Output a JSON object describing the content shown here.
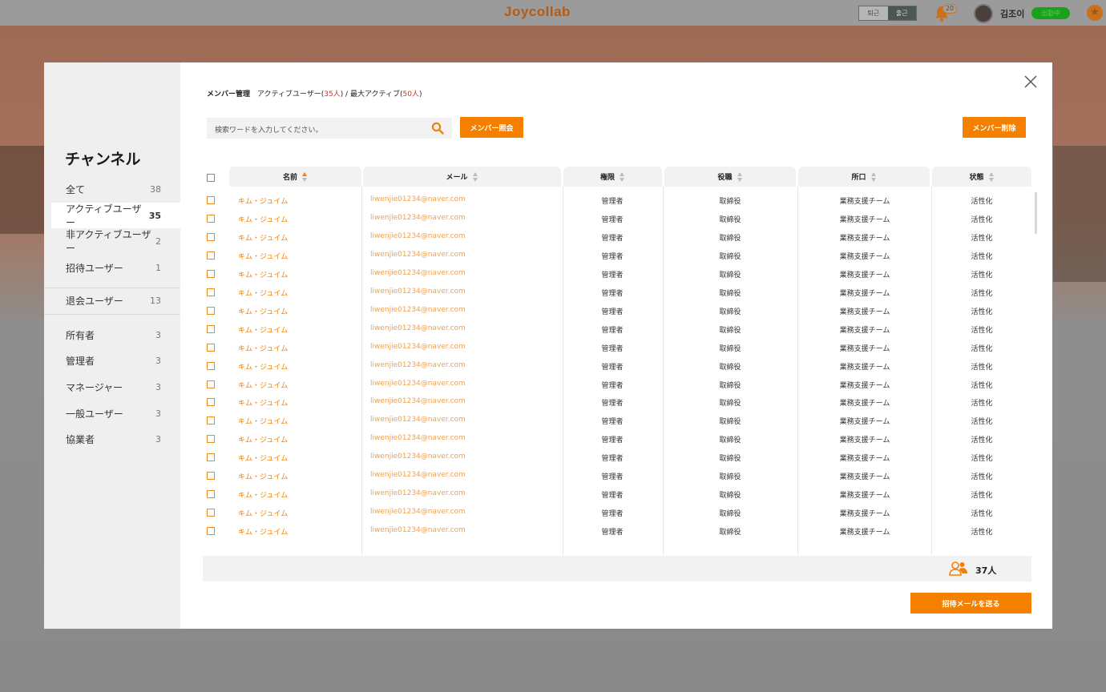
{
  "app": {
    "brand": "Joycollab",
    "toggle": [
      "퇴근",
      "출근"
    ],
    "notification_count": "20",
    "user_name": "김조이",
    "status": "出勤中"
  },
  "sidebar": {
    "title": "チャンネル",
    "groups": [
      [
        {
          "label": "全て",
          "count": "38"
        },
        {
          "label": "アクティブユーザー",
          "count": "35"
        },
        {
          "label": "非アクティブユーザー",
          "count": "2"
        },
        {
          "label": "招待ユーザー",
          "count": "1"
        }
      ],
      [
        {
          "label": "退会ユーザー",
          "count": "13"
        }
      ],
      [
        {
          "label": "所有者",
          "count": "3"
        },
        {
          "label": "管理者",
          "count": "3"
        },
        {
          "label": "マネージャー",
          "count": "3"
        },
        {
          "label": "一般ユーザー",
          "count": "3"
        },
        {
          "label": "協業者",
          "count": "3"
        }
      ]
    ]
  },
  "header": {
    "title": "メンバー管理",
    "active_label": "アクティブユーザー(",
    "active_count": "35人",
    "separator": ") / 最大アクティブ(",
    "max_count": "50人",
    "close_paren": ")"
  },
  "search": {
    "placeholder": "検索ワードを入力してください。"
  },
  "buttons": {
    "lookup": "メンバー照会",
    "delete": "メンバー削除",
    "invite": "招待メールを送る"
  },
  "table": {
    "columns": [
      "名前",
      "メール",
      "権限",
      "役職",
      "所口",
      "状態"
    ],
    "rows": [
      {
        "name": "キム・ジュイム",
        "email": "liwenjie01234@naver.com",
        "role": "管理者",
        "position": "取締役",
        "dept": "業務支援チーム",
        "status": "活性化"
      },
      {
        "name": "キム・ジュイム",
        "email": "liwenjie01234@naver.com",
        "role": "管理者",
        "position": "取締役",
        "dept": "業務支援チーム",
        "status": "活性化"
      },
      {
        "name": "キム・ジュイム",
        "email": "liwenjie01234@naver.com",
        "role": "管理者",
        "position": "取締役",
        "dept": "業務支援チーム",
        "status": "活性化"
      },
      {
        "name": "キム・ジュイム",
        "email": "liwenjie01234@naver.com",
        "role": "管理者",
        "position": "取締役",
        "dept": "業務支援チーム",
        "status": "活性化"
      },
      {
        "name": "キム・ジュイム",
        "email": "liwenjie01234@naver.com",
        "role": "管理者",
        "position": "取締役",
        "dept": "業務支援チーム",
        "status": "活性化"
      },
      {
        "name": "キム・ジュイム",
        "email": "liwenjie01234@naver.com",
        "role": "管理者",
        "position": "取締役",
        "dept": "業務支援チーム",
        "status": "活性化"
      },
      {
        "name": "キム・ジュイム",
        "email": "liwenjie01234@naver.com",
        "role": "管理者",
        "position": "取締役",
        "dept": "業務支援チーム",
        "status": "活性化"
      },
      {
        "name": "キム・ジュイム",
        "email": "liwenjie01234@naver.com",
        "role": "管理者",
        "position": "取締役",
        "dept": "業務支援チーム",
        "status": "活性化"
      },
      {
        "name": "キム・ジュイム",
        "email": "liwenjie01234@naver.com",
        "role": "管理者",
        "position": "取締役",
        "dept": "業務支援チーム",
        "status": "活性化"
      },
      {
        "name": "キム・ジュイム",
        "email": "liwenjie01234@naver.com",
        "role": "管理者",
        "position": "取締役",
        "dept": "業務支援チーム",
        "status": "活性化"
      },
      {
        "name": "キム・ジュイム",
        "email": "liwenjie01234@naver.com",
        "role": "管理者",
        "position": "取締役",
        "dept": "業務支援チーム",
        "status": "活性化"
      },
      {
        "name": "キム・ジュイム",
        "email": "liwenjie01234@naver.com",
        "role": "管理者",
        "position": "取締役",
        "dept": "業務支援チーム",
        "status": "活性化"
      },
      {
        "name": "キム・ジュイム",
        "email": "liwenjie01234@naver.com",
        "role": "管理者",
        "position": "取締役",
        "dept": "業務支援チーム",
        "status": "活性化"
      },
      {
        "name": "キム・ジュイム",
        "email": "liwenjie01234@naver.com",
        "role": "管理者",
        "position": "取締役",
        "dept": "業務支援チーム",
        "status": "活性化"
      },
      {
        "name": "キム・ジュイム",
        "email": "liwenjie01234@naver.com",
        "role": "管理者",
        "position": "取締役",
        "dept": "業務支援チーム",
        "status": "活性化"
      },
      {
        "name": "キム・ジュイム",
        "email": "liwenjie01234@naver.com",
        "role": "管理者",
        "position": "取締役",
        "dept": "業務支援チーム",
        "status": "活性化"
      },
      {
        "name": "キム・ジュイム",
        "email": "liwenjie01234@naver.com",
        "role": "管理者",
        "position": "取締役",
        "dept": "業務支援チーム",
        "status": "活性化"
      },
      {
        "name": "キム・ジュイム",
        "email": "liwenjie01234@naver.com",
        "role": "管理者",
        "position": "取締役",
        "dept": "業務支援チーム",
        "status": "活性化"
      },
      {
        "name": "キム・ジュイム",
        "email": "liwenjie01234@naver.com",
        "role": "管理者",
        "position": "取締役",
        "dept": "業務支援チーム",
        "status": "活性化"
      }
    ]
  },
  "footer": {
    "total": "37人"
  },
  "colors": {
    "accent": "#f58000",
    "highlight": "#c0392b"
  }
}
